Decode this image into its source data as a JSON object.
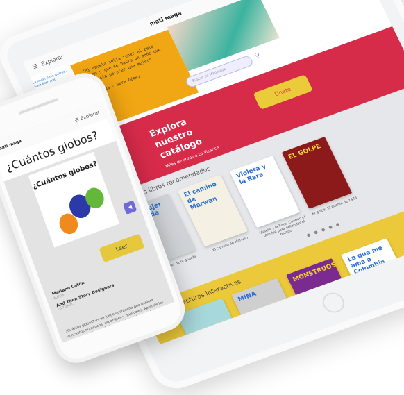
{
  "tablet": {
    "nav": {
      "menu_label": "Explorar",
      "logo": "mati maga"
    },
    "quote": {
      "text": "\"Mi abuela solía tener el pelo largo y que se hacía un moño que le hacía parecer una mujer\"",
      "source": "Cándida - Sara Gómez"
    },
    "sidebar": {
      "link": "La mujer de la guarda - Sara Bertrand"
    },
    "search": {
      "placeholder": "Buscar en Matimaga"
    },
    "banner": {
      "title": "Explora nuestro catálogo",
      "subtitle": "Miles de libros a tu alcance",
      "button": "Únete"
    },
    "recommended": {
      "title": "Nuestros libros recomendados",
      "books": [
        {
          "cover": "La mujer guarda",
          "caption": "La mujer de la guarda",
          "color": "#cfd2d6"
        },
        {
          "cover": "El camino de Marwan",
          "caption": "El camino de Marwan",
          "color": "#f4f1e4"
        },
        {
          "cover": "Violeta y la Rara",
          "caption": "Violeta y la Rara: Cuando el otro fue para entender el mundo",
          "color": "#ffffff"
        },
        {
          "cover": "EL GOLPE",
          "caption": "El golpe: El pueblo de 1973",
          "color": "#8d1a1a"
        }
      ]
    },
    "interactive": {
      "title": "Lecturas interactivas",
      "books": [
        {
          "cover": "",
          "color": "#a7d8dc"
        },
        {
          "cover": "MINA",
          "color": "#cfcfcf"
        },
        {
          "cover": "MONSTRUOS",
          "color": "#7b2a8f"
        },
        {
          "cover": "La que me ama a Colombia",
          "color": "#ffffff"
        }
      ]
    }
  },
  "phone": {
    "nav": {
      "logo": "mati maga",
      "menu_label": "Explorar"
    },
    "title": "¿Cuántos globos?",
    "cover_title": "¿Cuántos globos?",
    "read_button": "Leer",
    "author": "Mariano Catón",
    "author_label": "AUTOR",
    "publisher": "And Then Story Designers",
    "publisher_label": "EDITORIAL",
    "description": "¿Cuántos globos? es un juego-cuentecito que explora conceptos numéricos, espaciales y musicales. Aprende los números mientras disfrutas animales, prácticas alegres, paisajes y tocar música. Este libro es interactivo."
  }
}
